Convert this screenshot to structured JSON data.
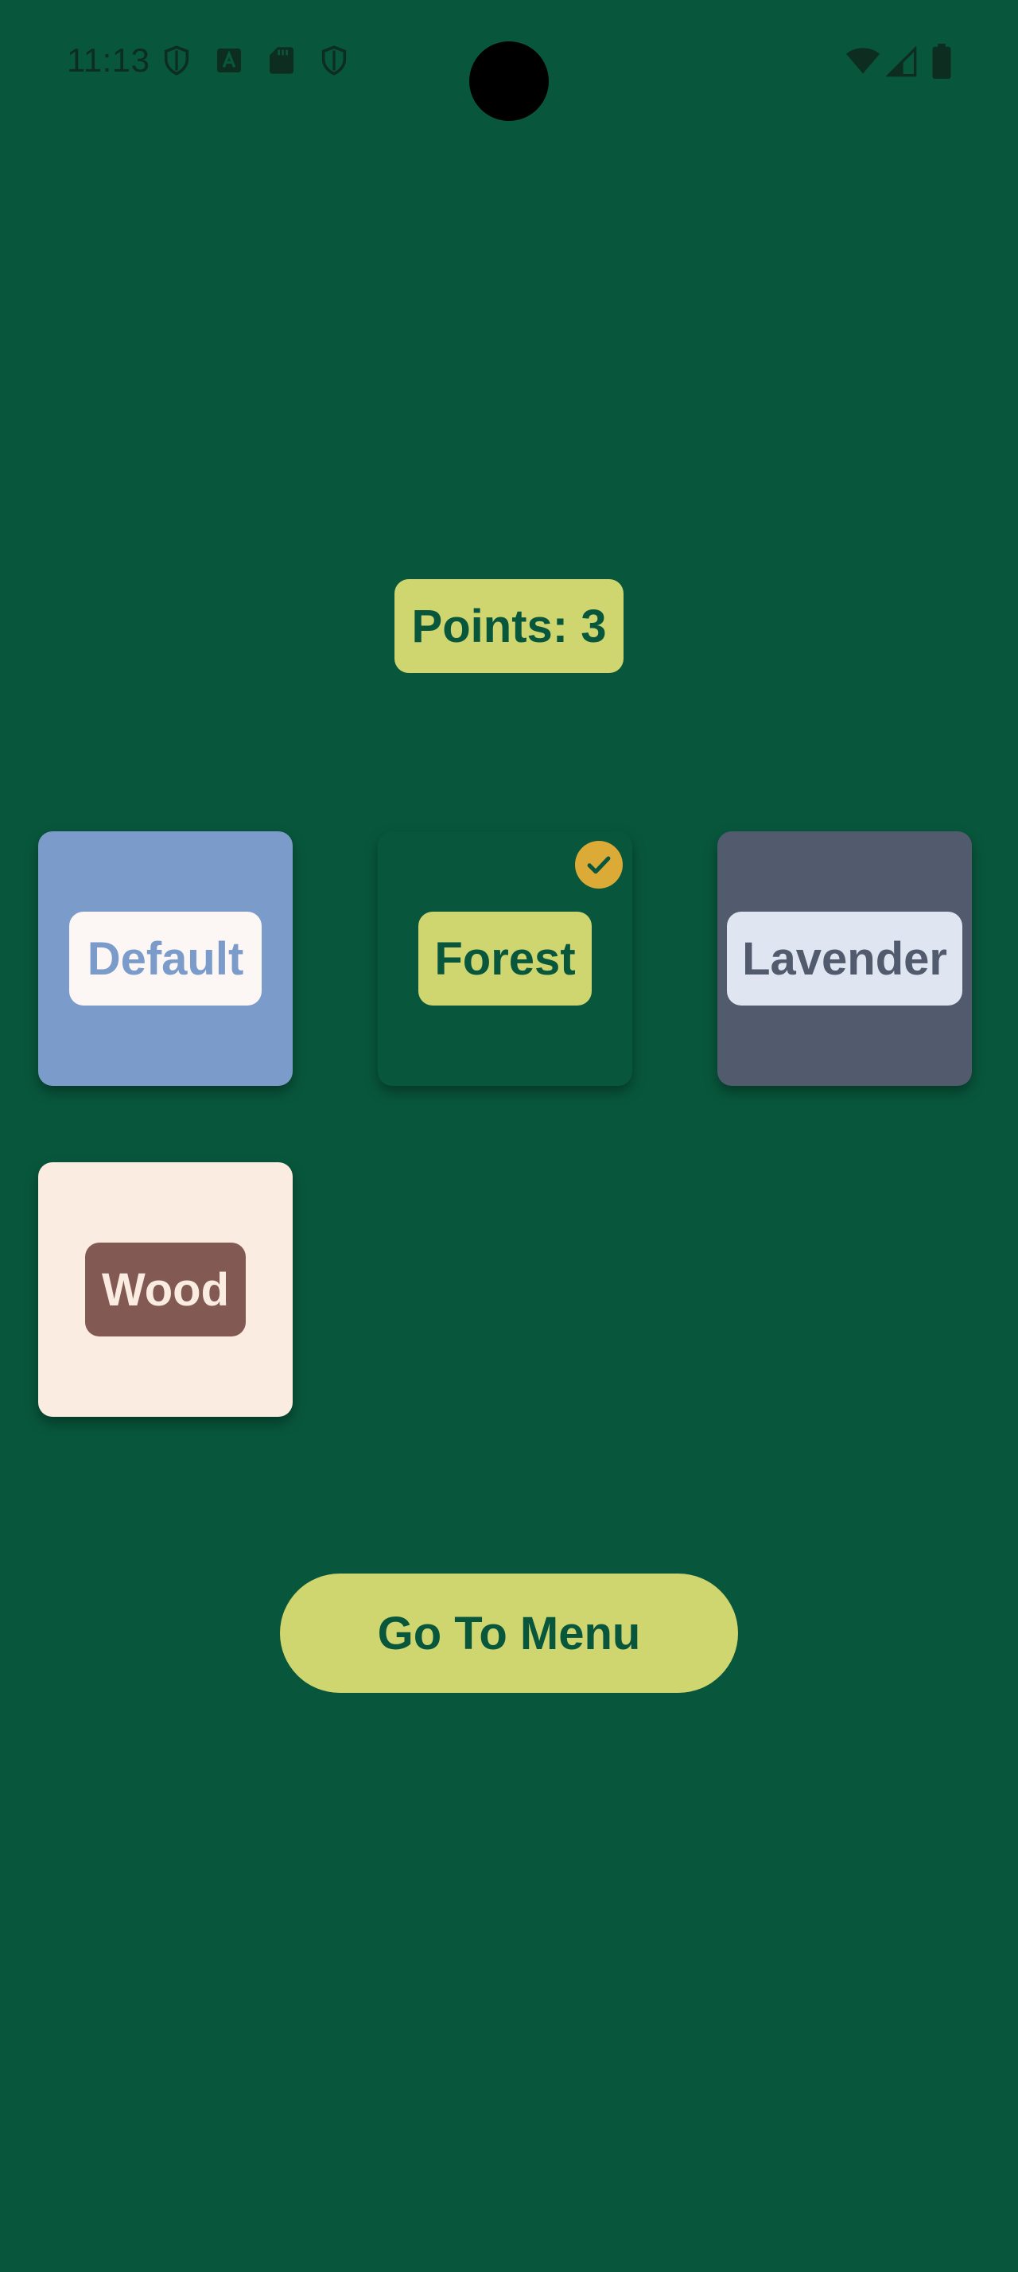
{
  "status_bar": {
    "time": "11:13",
    "left_icons": [
      "shield-icon",
      "keyboard-a-icon",
      "sd-card-icon",
      "shield-icon"
    ],
    "right_icons": [
      "wifi-icon",
      "signal-icon",
      "battery-icon"
    ],
    "icon_color": "#0d2d21"
  },
  "points": {
    "label": "Points: 3",
    "bg_color": "#cfd56f",
    "text_color": "#08573c"
  },
  "themes": [
    {
      "name": "Default",
      "card_color": "#7b9bcb",
      "label_bg": "#fcf6f5",
      "label_color": "#7b9bcb",
      "selected": false
    },
    {
      "name": "Forest",
      "card_color": "#08573c",
      "label_bg": "#cfd56f",
      "label_color": "#08573c",
      "selected": true,
      "check_color": "#dcaa36"
    },
    {
      "name": "Lavender",
      "card_color": "#525a6e",
      "label_bg": "#e0e5f2",
      "label_color": "#525a6e",
      "selected": false
    },
    {
      "name": "Wood",
      "card_color": "#faece1",
      "label_bg": "#825953",
      "label_color": "#faece1",
      "selected": false
    }
  ],
  "menu_button": {
    "label": "Go To Menu",
    "bg_color": "#cfd56f",
    "text_color": "#08573c"
  },
  "background_color": "#08573c"
}
